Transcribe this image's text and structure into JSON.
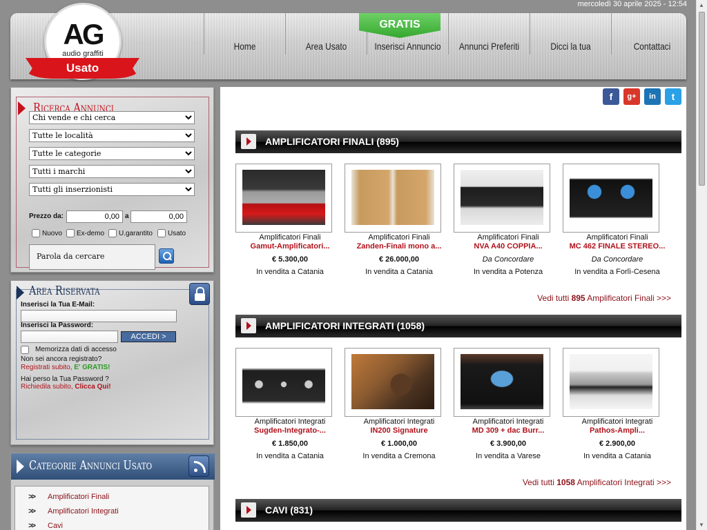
{
  "date": "mercoledì 30 aprile 2025 - 12:54",
  "logo": {
    "ag": "AG",
    "sub": "audio graffiti",
    "ribbon": "Usato"
  },
  "nav": {
    "gratis": "GRATIS",
    "items": [
      "Home",
      "Area Usato",
      "Inserisci Annuncio",
      "Annunci Preferiti",
      "Dicci la tua",
      "Contattaci"
    ]
  },
  "search": {
    "title": "Ricerca Annunci",
    "selects": [
      "Chi vende e chi cerca",
      "Tutte le località",
      "Tutte le categorie",
      "Tutti i marchi",
      "Tutti gli inserzionisti"
    ],
    "prezzo_label": "Prezzo da:",
    "prezzo_from": "0,00",
    "a_label": "a",
    "prezzo_to": "0,00",
    "checks": [
      "Nuovo",
      "Ex-demo",
      "U.garantito",
      "Usato"
    ],
    "parola": "Parola da cercare"
  },
  "area": {
    "title": "Area Riservata",
    "email_label": "Inserisci la Tua E-Mail:",
    "pwd_label": "Inserisci la Password:",
    "accedi": "ACCEDI >",
    "memorizza": "Memorizza dati di accesso",
    "non_reg": "Non sei ancora registrato?",
    "reg_link": "Registrati subito, ",
    "gratis": "E' GRATIS!",
    "lost": "Hai perso la Tua Password ?",
    "richiedi": "Richiedila subito, ",
    "clicca": "Clicca Qui!"
  },
  "categories": {
    "title": "Categorie Annunci Usato",
    "items": [
      "Amplificatori Finali",
      "Amplificatori Integrati",
      "Cavi"
    ]
  },
  "social": [
    "f",
    "g+",
    "in",
    "t"
  ],
  "sections": [
    {
      "title": "AMPLIFICATORI FINALI (895)",
      "products": [
        {
          "cat": "Amplificatori Finali",
          "name": "Gamut-Amplificatori...",
          "price": "€ 5.300,00",
          "cond": "",
          "loc": "In vendita a Catania"
        },
        {
          "cat": "Amplificatori Finali",
          "name": "Zanden-Finali mono a...",
          "price": "€ 26.000,00",
          "cond": "",
          "loc": "In vendita a Catania"
        },
        {
          "cat": "Amplificatori Finali",
          "name": "NVA A40 COPPIA...",
          "price": "",
          "cond": "Da Concordare",
          "loc": "In vendita a Potenza"
        },
        {
          "cat": "Amplificatori Finali",
          "name": "MC 462 FINALE STEREO...",
          "price": "",
          "cond": "Da Concordare",
          "loc": "In vendita a Forlì-Cesena"
        }
      ],
      "vedi_pre": "Vedi tutti ",
      "vedi_num": "895",
      "vedi_post": " Amplificatori Finali >>>"
    },
    {
      "title": "AMPLIFICATORI INTEGRATI (1058)",
      "products": [
        {
          "cat": "Amplificatori Integrati",
          "name": "Sugden-Integrato-...",
          "price": "€ 1.850,00",
          "cond": "",
          "loc": "In vendita a Catania"
        },
        {
          "cat": "Amplificatori Integrati",
          "name": "IN200 Signature",
          "price": "€ 1.000,00",
          "cond": "",
          "loc": "In vendita a Cremona"
        },
        {
          "cat": "Amplificatori Integrati",
          "name": "MD 309 + dac Burr...",
          "price": "€ 3.900,00",
          "cond": "",
          "loc": "In vendita a Varese"
        },
        {
          "cat": "Amplificatori Integrati",
          "name": "Pathos-Ampli...",
          "price": "€ 2.900,00",
          "cond": "",
          "loc": "In vendita a Catania"
        }
      ],
      "vedi_pre": "Vedi tutti ",
      "vedi_num": "1058",
      "vedi_post": " Amplificatori Integrati >>>"
    },
    {
      "title": "CAVI (831)"
    }
  ]
}
